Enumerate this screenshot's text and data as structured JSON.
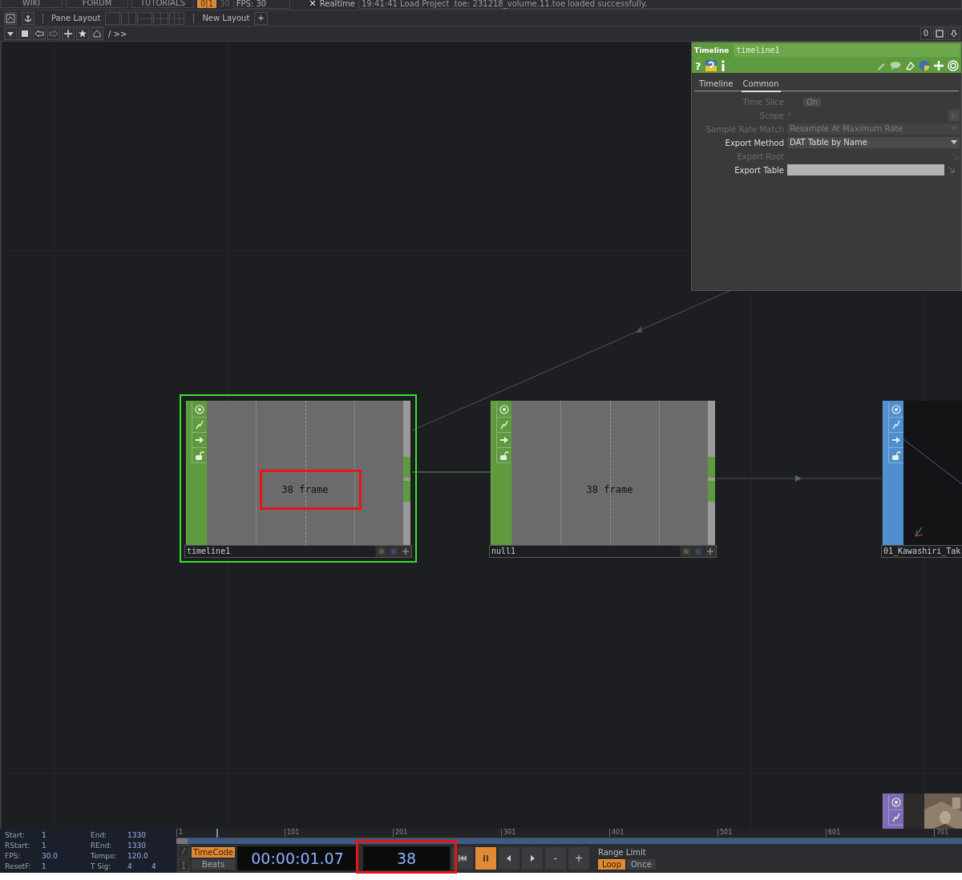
{
  "menu_bar": {
    "items": [
      "WIKI",
      "FORUM",
      "TUTORIALS"
    ],
    "toggle": {
      "label": "0|1",
      "on": true
    },
    "cook_rate": "30",
    "fps": "FPS:  30",
    "realtime": {
      "label": "Realtime",
      "checked": true
    },
    "status": "19:41:41 Load Project .toe: 231218_volume.11.toe loaded successfully."
  },
  "pane_bar": {
    "pane_layout": "Pane Layout",
    "new_layout": "New Layout",
    "plus": "+"
  },
  "path_bar": {
    "path": "/ >>",
    "counter": "0"
  },
  "parameters": {
    "op_type": "Timeline",
    "op_name": "timeline1",
    "help": "?",
    "tabs": [
      {
        "label": "Timeline",
        "selected": false
      },
      {
        "label": "Common",
        "selected": true
      }
    ],
    "params": [
      {
        "kind": "toggle",
        "label": "Time Slice",
        "value": "On",
        "disabled": true
      },
      {
        "kind": "text",
        "label": "Scope",
        "value": "*",
        "disabled": true
      },
      {
        "kind": "menu",
        "label": "Sample Rate Match",
        "value": "Resample At Maximum Rate",
        "disabled": true
      },
      {
        "kind": "menu",
        "label": "Export Method",
        "value": "DAT Table by Name",
        "disabled": false
      },
      {
        "kind": "empty",
        "label": "Export Root",
        "disabled": true
      },
      {
        "kind": "field",
        "label": "Export Table",
        "disabled": false
      }
    ]
  },
  "nodes": [
    {
      "name": "timeline1",
      "kind": "chop",
      "color": "#5e9a3e",
      "selected": true,
      "display": "38 frame",
      "highlighted": true
    },
    {
      "name": "null1",
      "kind": "chop",
      "color": "#5e9a3e",
      "selected": false,
      "display": "38 frame"
    },
    {
      "name": "01_Kawashiri_Tak",
      "kind": "geo",
      "color": "#4f8fcf",
      "selected": false
    },
    {
      "kind": "top",
      "color": "#7d6bb5",
      "selected": false
    }
  ],
  "timeline": {
    "info": [
      {
        "label": "Start:",
        "value": "1"
      },
      {
        "label": "End:",
        "value": "1330"
      },
      {
        "label": "RStart:",
        "value": "1"
      },
      {
        "label": "REnd:",
        "value": "1330"
      },
      {
        "label": "FPS:",
        "value": "30.0"
      },
      {
        "label": "Tempo:",
        "value": "120.0"
      },
      {
        "label": "ResetF:",
        "value": "1"
      },
      {
        "label": "T Sig:",
        "value": "4",
        "value2": "4"
      }
    ],
    "ruler": [
      "1",
      "101",
      "201",
      "301",
      "401",
      "501",
      "601",
      "701"
    ],
    "playhead": {
      "level": 0.051
    },
    "units": [
      {
        "label": "TimeCode",
        "selected": true
      },
      {
        "label": "Beats",
        "selected": false
      }
    ],
    "timecode": "00:00:01.07",
    "frame": {
      "value": "38",
      "highlighted": true
    },
    "playing": true,
    "step_buttons": [
      "-",
      "+"
    ],
    "range_limit": "Range Limit",
    "modes": [
      {
        "label": "Loop",
        "selected": true
      },
      {
        "label": "Once",
        "selected": false
      }
    ]
  }
}
